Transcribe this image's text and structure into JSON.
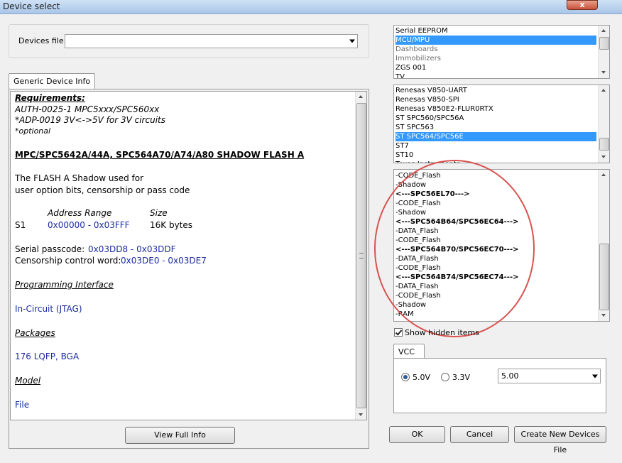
{
  "window": {
    "title": "Device select",
    "close_glyph": "x"
  },
  "devices_file": {
    "label": "Devices file:",
    "value": ""
  },
  "info_tab": {
    "label": "Generic Device Info"
  },
  "info": {
    "requirements_title": "Requirements:",
    "req_lines": [
      "AUTH-0025-1 MPC5xxx/SPC560xx",
      "*ADP-0019 3V<->5V for 3V circuits",
      "*optional"
    ],
    "device_title": "MPC/SPC5642A/44A, SPC564A70/A74/A80 SHADOW FLASH A",
    "desc_lines": [
      "The FLASH A Shadow used for",
      "user option bits, censorship or pass code"
    ],
    "table_header": {
      "range": "Address Range",
      "size": "Size"
    },
    "table_row": {
      "name": "S1",
      "range": "0x00000 - 0x03FFF",
      "size": "16K bytes"
    },
    "passcode_label": "Serial passcode:",
    "passcode_value": "0x03DD8 - 0x03DDF",
    "censor_label": "Censorship control word:",
    "censor_value": "0x03DE0 - 0x03DE7",
    "prog_title": "Programming Interface",
    "prog_value": "In-Circuit (JTAG)",
    "pkg_title": "Packages",
    "pkg_value": "176 LQFP, BGA",
    "model_title": "Model",
    "model_value": "File"
  },
  "view_full_info": "View Full Info",
  "category_list": [
    {
      "label": "Serial EEPROM",
      "state": "normal"
    },
    {
      "label": "MCU/MPU",
      "state": "selected"
    },
    {
      "label": "Dashboards",
      "state": "grey"
    },
    {
      "label": "Immobilizers",
      "state": "grey"
    },
    {
      "label": "ZGS 001",
      "state": "normal"
    },
    {
      "label": "TV",
      "state": "normal"
    }
  ],
  "family_list": [
    {
      "label": "Renesas V850-UART",
      "state": "normal"
    },
    {
      "label": "Renesas V850-SPI",
      "state": "normal"
    },
    {
      "label": "Renesas V850E2-FLUR0RTX",
      "state": "normal"
    },
    {
      "label": "ST SPC560/SPC56A",
      "state": "normal"
    },
    {
      "label": "ST SPC563",
      "state": "normal"
    },
    {
      "label": "ST SPC564/SPC56E",
      "state": "selected"
    },
    {
      "label": "ST7",
      "state": "normal"
    },
    {
      "label": "ST10",
      "state": "normal"
    },
    {
      "label": "Texas Instruments",
      "state": "normal"
    }
  ],
  "device_list": [
    {
      "label": "-CODE_Flash",
      "state": "normal"
    },
    {
      "label": "-Shadow",
      "state": "normal"
    },
    {
      "label": "<---SPC56EL70--->",
      "state": "bold"
    },
    {
      "label": "-CODE_Flash",
      "state": "normal"
    },
    {
      "label": "-Shadow",
      "state": "normal"
    },
    {
      "label": "<---SPC564B64/SPC56EC64--->",
      "state": "bold"
    },
    {
      "label": "-DATA_Flash",
      "state": "normal"
    },
    {
      "label": "-CODE_Flash",
      "state": "normal"
    },
    {
      "label": "<---SPC564B70/SPC56EC70--->",
      "state": "bold"
    },
    {
      "label": "-DATA_Flash",
      "state": "normal"
    },
    {
      "label": "-CODE_Flash",
      "state": "normal"
    },
    {
      "label": "<---SPC564B74/SPC56EC74--->",
      "state": "bold"
    },
    {
      "label": "-DATA_Flash",
      "state": "normal"
    },
    {
      "label": "-CODE_Flash",
      "state": "normal"
    },
    {
      "label": "-Shadow",
      "state": "normal"
    },
    {
      "label": "-RAM",
      "state": "normal"
    }
  ],
  "show_hidden": {
    "label": "Show hidden items",
    "checked": true
  },
  "vcc": {
    "tab": "VCC",
    "opt_5v": "5.0V",
    "opt_33v": "3.3V",
    "selected": "5.0V",
    "voltage_value": "5.00"
  },
  "buttons": {
    "ok": "OK",
    "cancel": "Cancel",
    "create": "Create New Devices File"
  },
  "colors": {
    "selection": "#3399ff",
    "annotation_circle": "#d9534f",
    "link_blue": "#1a2ca0"
  },
  "icons": [
    "close-icon",
    "dropdown-arrow-icon",
    "scroll-up-icon",
    "scroll-down-icon",
    "checkbox-icon",
    "radio-icon",
    "grip-icon"
  ]
}
